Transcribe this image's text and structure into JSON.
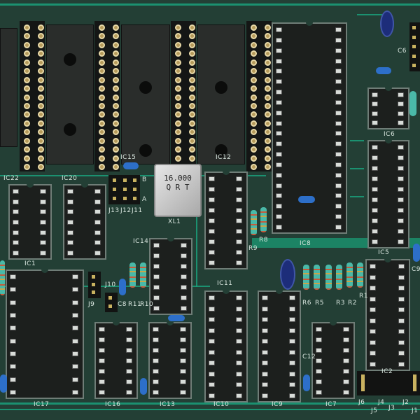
{
  "components": {
    "ic22": "IC22",
    "ic20": "IC20",
    "ic15": "IC15",
    "ic12": "IC12",
    "ic8": "IC8",
    "ic6": "IC6",
    "ic5": "IC5",
    "ic14": "IC14",
    "ic11": "IC11",
    "ic10": "IC10",
    "ic9": "IC9",
    "ic7": "IC7",
    "ic13": "IC13",
    "ic16": "IC16",
    "ic17": "IC17",
    "ic2": "IC2",
    "ic1": "IC1",
    "crystal": "16.000\nQ R T",
    "xl1": "XL1",
    "r1": "R1",
    "r2": "R2",
    "r3": "R3",
    "r5": "R5",
    "r6": "R6",
    "r8": "R8",
    "r9": "R9",
    "r10": "R10",
    "r11": "R11",
    "c6": "C6",
    "c8": "C8",
    "c9": "C9",
    "c12": "C12",
    "j1": "J1",
    "j2": "J2",
    "j3": "J3",
    "j4": "J4",
    "j5": "J5",
    "j6": "J6",
    "j9": "J9",
    "j10": "J10",
    "j11": "J11",
    "j12": "J12",
    "j13": "J13",
    "a": "A",
    "b": "B"
  },
  "colors": {
    "board": "#233f35",
    "trace": "#1aa07a",
    "socket": "#1c1f1d",
    "pin": "#d8dcd8"
  }
}
